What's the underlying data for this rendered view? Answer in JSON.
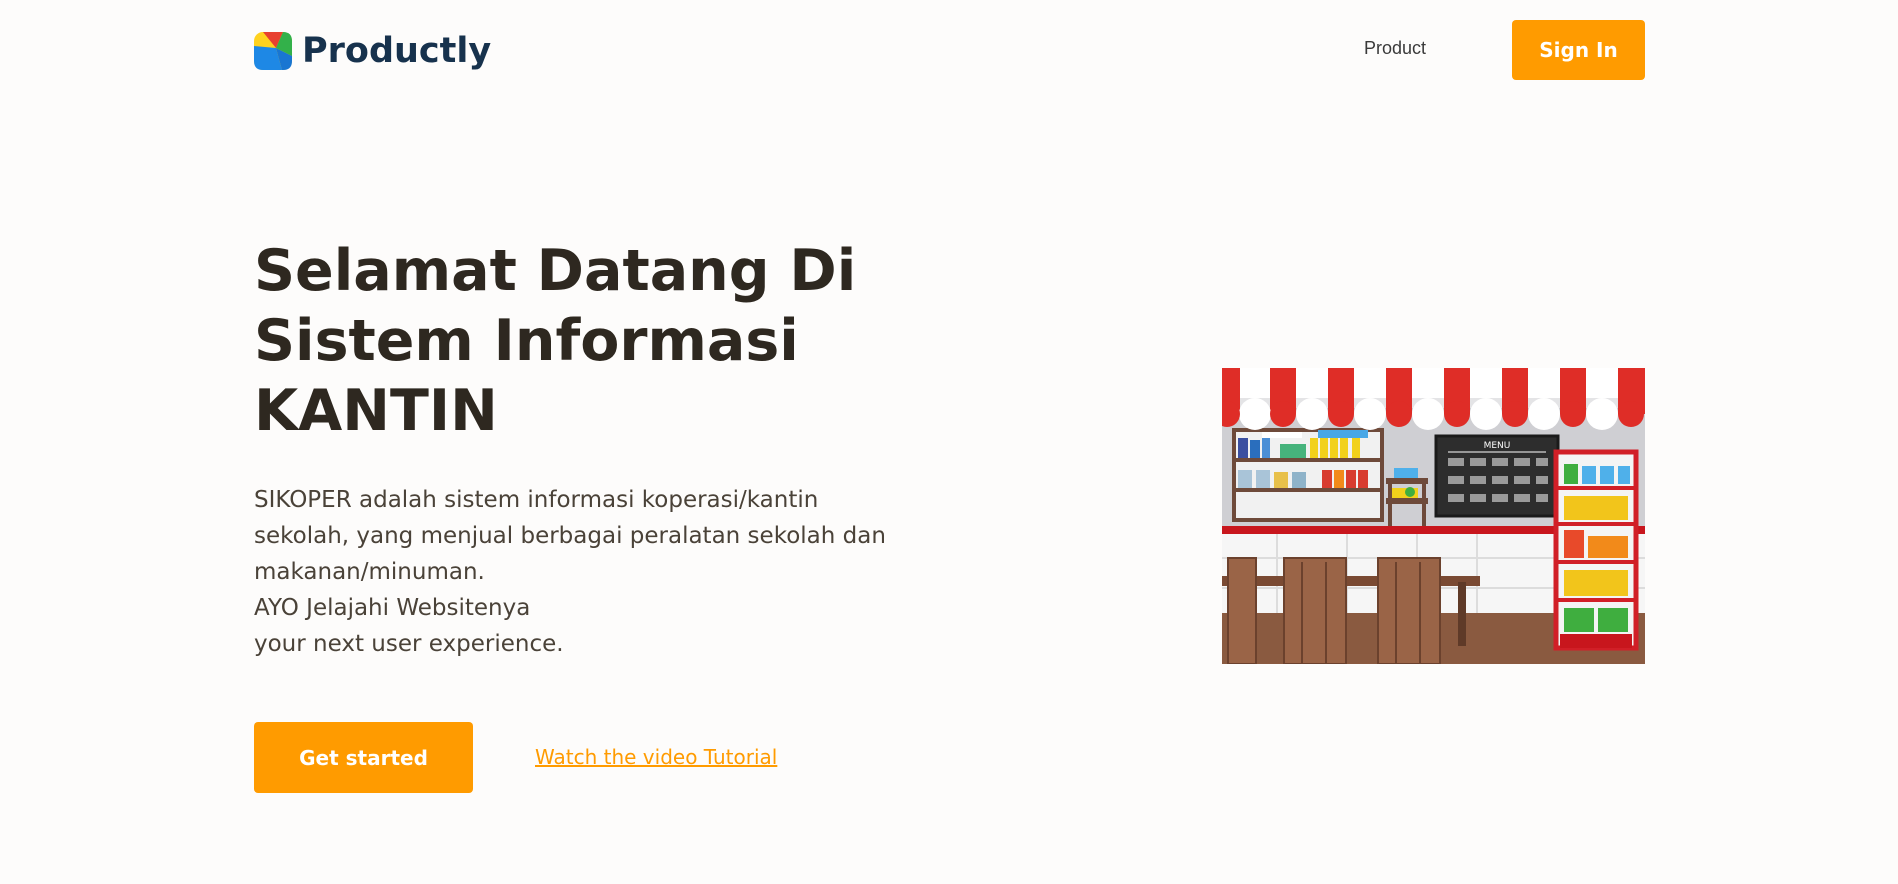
{
  "header": {
    "brand": "Productly",
    "nav": {
      "product_label": "Product"
    },
    "signin_label": "Sign In"
  },
  "hero": {
    "title_lines": [
      "Selamat Datang Di",
      "Sistem Informasi",
      "KANTIN"
    ],
    "description_lines": [
      "SIKOPER adalah sistem informasi koperasi/kantin",
      "sekolah, yang menjual berbagai peralatan sekolah dan",
      "makanan/minuman.",
      "AYO Jelajahi Websitenya",
      "your next user experience."
    ],
    "cta_label": "Get started",
    "video_link_label": "Watch the video Tutorial"
  },
  "illustration": {
    "menu_board_label": "MENU"
  },
  "colors": {
    "accent": "#ff9b00",
    "heading": "#2e2820",
    "brand_text": "#17324d"
  },
  "icons": {
    "logo": "productly-logo-icon"
  }
}
